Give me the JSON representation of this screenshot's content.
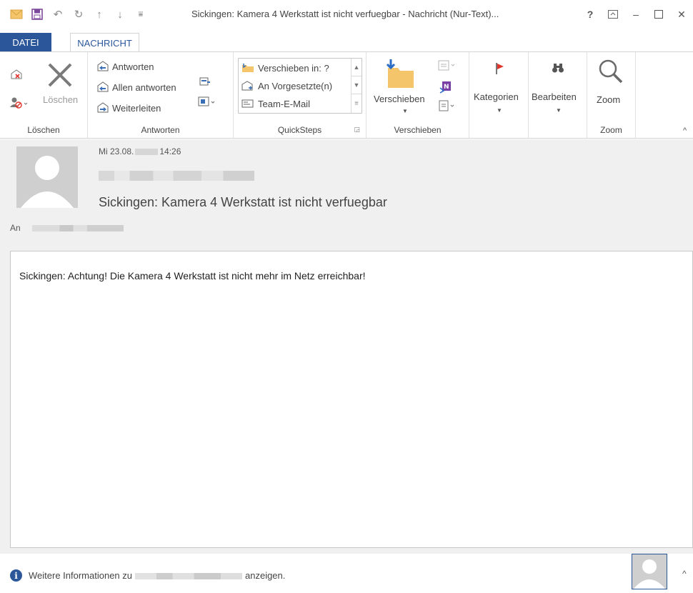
{
  "window": {
    "title": "Sickingen: Kamera 4 Werkstatt ist nicht verfuegbar - Nachricht (Nur-Text)...",
    "help": "?",
    "controls": {
      "minimize": "–",
      "maximize": "□",
      "close": "✕",
      "restore": "⧉"
    }
  },
  "tabs": {
    "file": "DATEI",
    "message": "NACHRICHT"
  },
  "ribbon": {
    "delete_group": {
      "label": "Löschen",
      "delete_button": "Löschen"
    },
    "respond_group": {
      "label": "Antworten",
      "reply": "Antworten",
      "reply_all": "Allen antworten",
      "forward": "Weiterleiten"
    },
    "quicksteps_group": {
      "label": "QuickSteps",
      "items": [
        "Verschieben in: ?",
        "An Vorgesetzte(n)",
        "Team-E-Mail"
      ]
    },
    "move_group": {
      "label": "Verschieben",
      "move_button": "Verschieben"
    },
    "tags_group": {
      "categories": "Kategorien"
    },
    "editing_group": {
      "edit": "Bearbeiten"
    },
    "zoom_group": {
      "label": "Zoom",
      "zoom_button": "Zoom"
    }
  },
  "message": {
    "date_prefix": "Mi 23.08.",
    "time": "14:26",
    "subject": "Sickingen: Kamera 4 Werkstatt ist nicht verfuegbar",
    "to_label": "An",
    "body": "Sickingen: Achtung! Die Kamera 4 Werkstatt ist nicht mehr im Netz erreichbar!"
  },
  "statusbar": {
    "info_prefix": "Weitere Informationen zu",
    "info_suffix": "anzeigen."
  },
  "colors": {
    "accent": "#2b579a",
    "header_bg": "#f0f0f0",
    "flag_red": "#e0342c"
  }
}
